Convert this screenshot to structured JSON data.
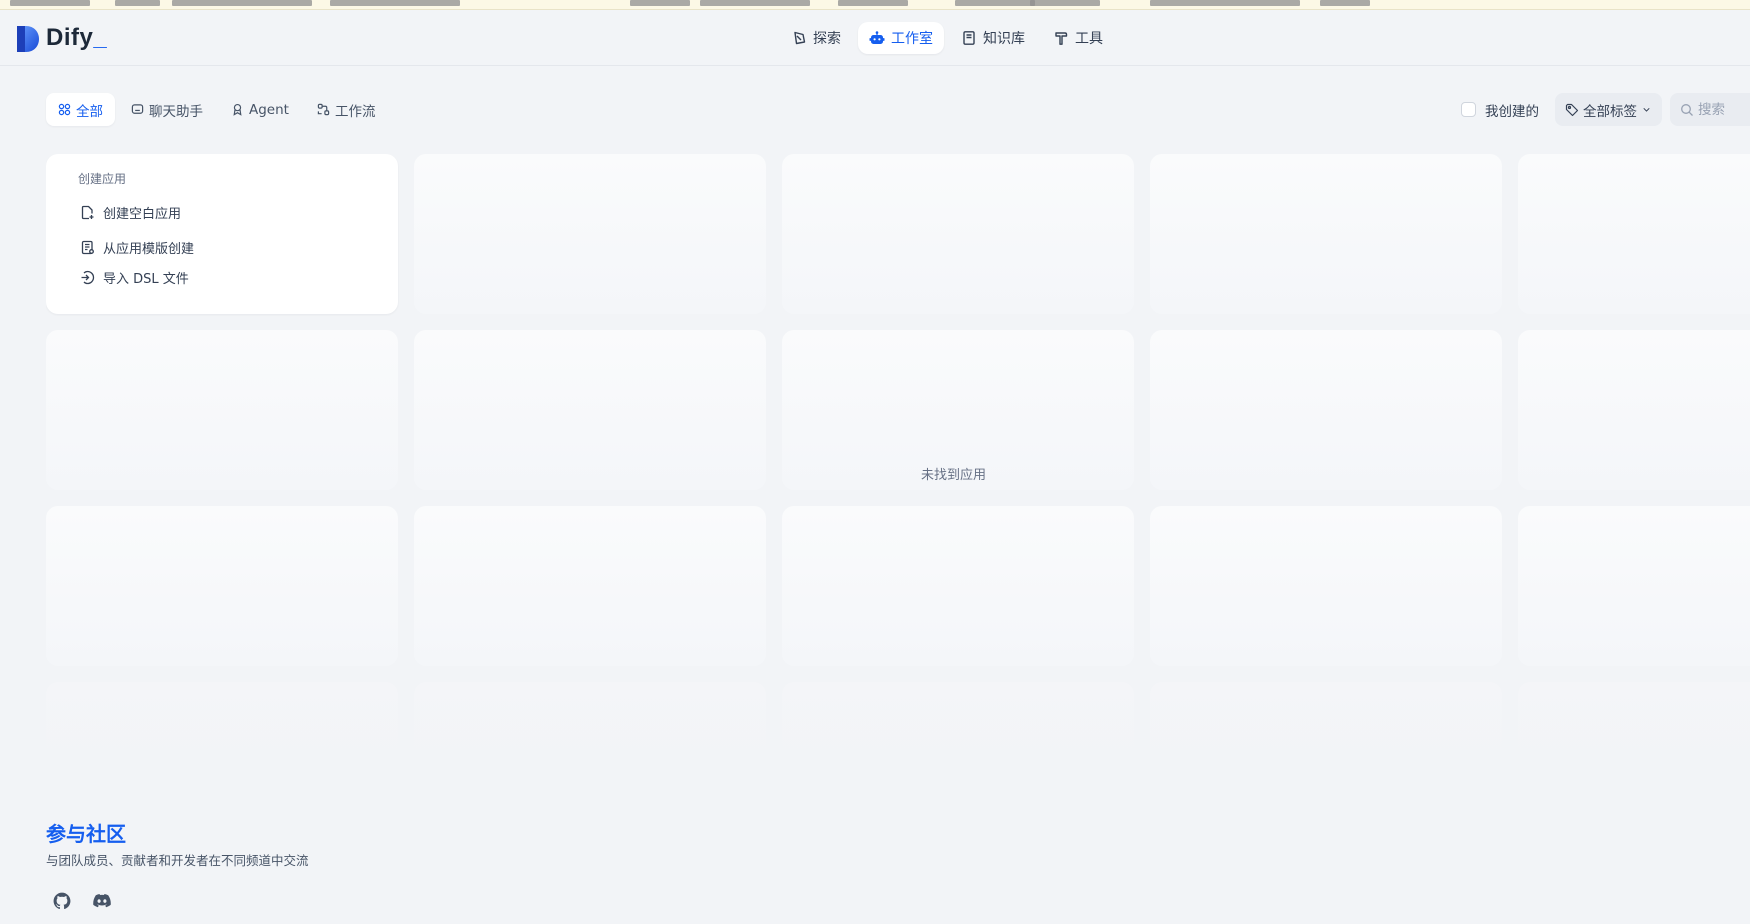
{
  "app": {
    "name": "Dify",
    "accent": "#155eef"
  },
  "nav": [
    {
      "id": "explore",
      "label": "探索",
      "icon": "compass-icon",
      "active": false
    },
    {
      "id": "studio",
      "label": "工作室",
      "icon": "robot-icon",
      "active": true
    },
    {
      "id": "datasets",
      "label": "知识库",
      "icon": "book-icon",
      "active": false
    },
    {
      "id": "tools",
      "label": "工具",
      "icon": "hammer-icon",
      "active": false
    }
  ],
  "tabs": [
    {
      "label": "全部",
      "icon": "grid-icon",
      "active": true
    },
    {
      "label": "聊天助手",
      "icon": "chat-icon",
      "active": false
    },
    {
      "label": "Agent",
      "icon": "agent-icon",
      "active": false
    },
    {
      "label": "工作流",
      "icon": "workflow-icon",
      "active": false
    }
  ],
  "filters": {
    "created_by_me": "我创建的",
    "created_by_me_checked": false,
    "tags_label": "全部标签",
    "search_placeholder": "搜索",
    "search_value": ""
  },
  "create_card": {
    "title": "创建应用",
    "options": [
      {
        "label": "创建空白应用",
        "icon": "new-file-icon"
      },
      {
        "label": "从应用模版创建",
        "icon": "template-icon"
      },
      {
        "label": "导入 DSL 文件",
        "icon": "import-icon"
      }
    ]
  },
  "empty_state": "未找到应用",
  "community": {
    "title": "参与社区",
    "description": "与团队成员、贡献者和开发者在不同频道中交流",
    "links": [
      {
        "name": "github",
        "icon": "github-icon"
      },
      {
        "name": "discord",
        "icon": "discord-icon"
      }
    ]
  }
}
